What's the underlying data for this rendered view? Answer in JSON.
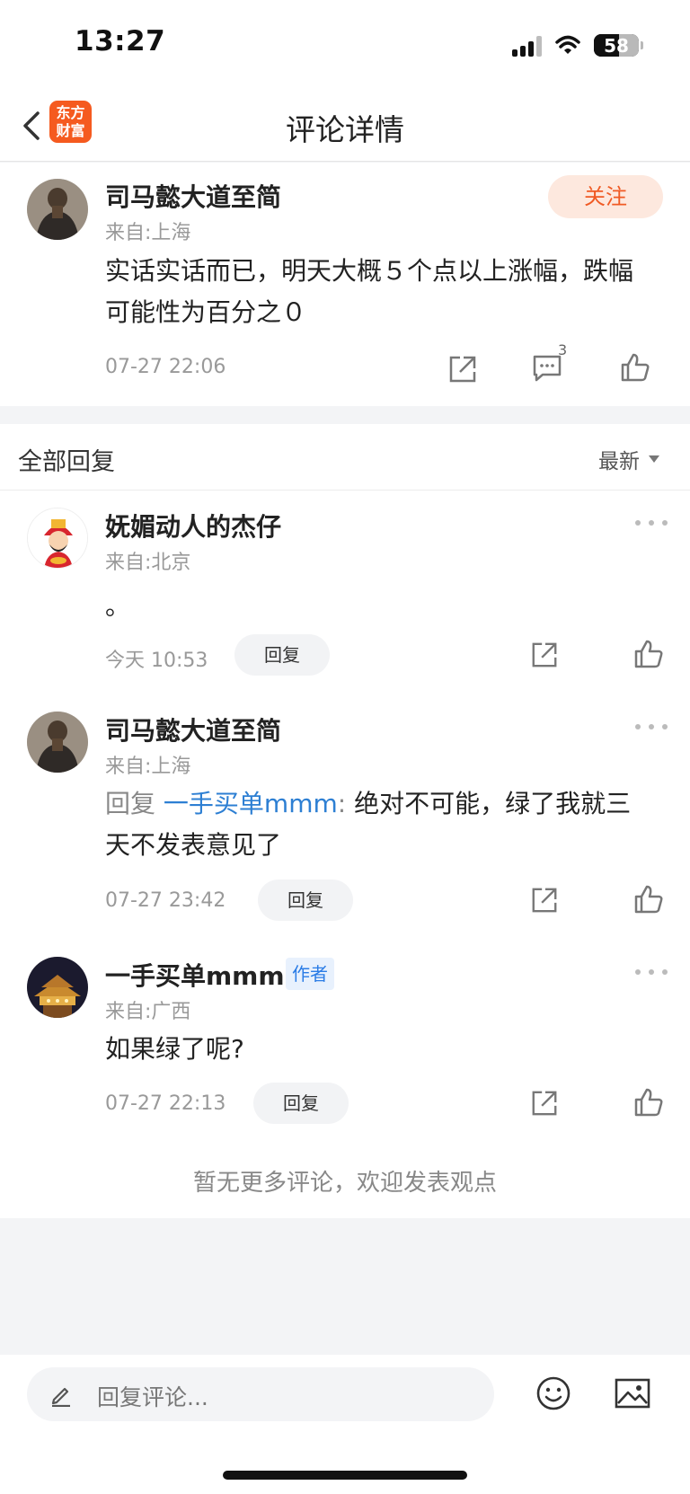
{
  "status_bar": {
    "time": "13:27",
    "battery": "58"
  },
  "nav": {
    "title": "评论详情",
    "logo_line1": "东方",
    "logo_line2": "财富"
  },
  "main_comment": {
    "user": "司马懿大道至简",
    "location": "来自:上海",
    "follow_label": "关注",
    "text": "实话实话而已，明天大概５个点以上涨幅，跌幅可能性为百分之０",
    "time": "07-27 22:06",
    "comment_count": "3"
  },
  "replies_section": {
    "title": "全部回复",
    "sort_label": "最新"
  },
  "replies": [
    {
      "user": "妩媚动人的杰仔",
      "location": "来自:北京",
      "text": "。",
      "time": "今天 10:53",
      "reply_label": "回复"
    },
    {
      "user": "司马懿大道至简",
      "location": "来自:上海",
      "reply_prefix": "回复",
      "reply_to": "一手买单mmm",
      "separator": ":",
      "text": "绝对不可能，绿了我就三天不发表意见了",
      "time": "07-27 23:42",
      "reply_label": "回复"
    },
    {
      "user": "一手买单mmm",
      "badge": "作者",
      "location": "来自:广西",
      "text": "如果绿了呢?",
      "time": "07-27 22:13",
      "reply_label": "回复"
    }
  ],
  "footer_note": "暂无更多评论，欢迎发表观点",
  "input": {
    "placeholder": "回复评论..."
  },
  "colors": {
    "accent": "#f05a24",
    "link": "#2d7fd3",
    "brand": "#f55a1f"
  }
}
